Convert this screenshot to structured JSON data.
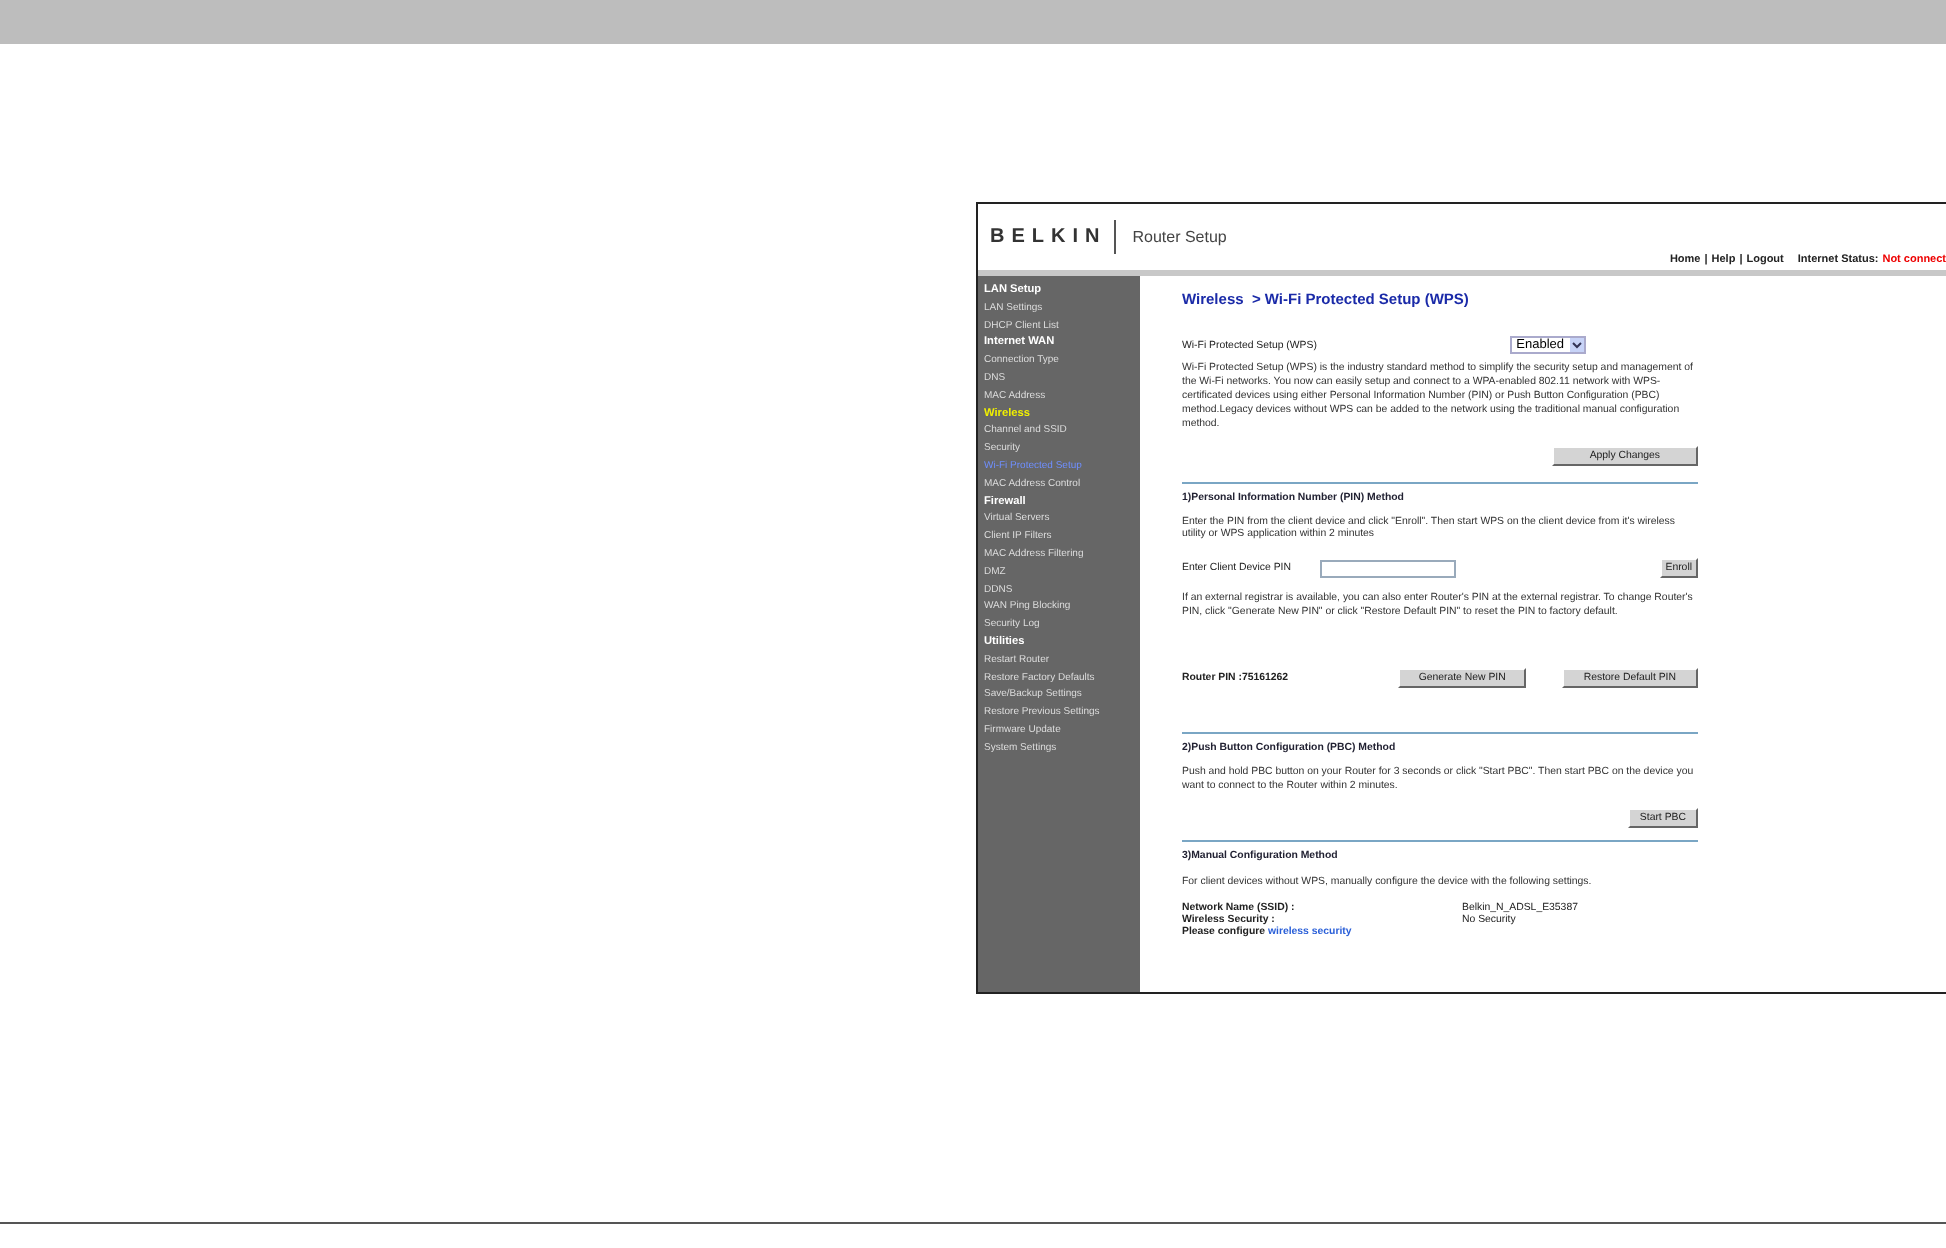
{
  "screenshot": {
    "logo": "BELKIN",
    "app_title": "Router Setup",
    "top_links": [
      "Home",
      "Help",
      "Logout"
    ],
    "link_separator": "|",
    "internet_status_label": "Internet Status:",
    "internet_status_value": "Not connect",
    "sidebar": {
      "items": [
        {
          "label": "LAN Setup",
          "kind": "heading",
          "selected": false
        },
        {
          "label": "LAN Settings",
          "kind": "link",
          "selected": false
        },
        {
          "label": "DHCP Client List",
          "kind": "link",
          "selected": false
        },
        {
          "label": "Internet WAN",
          "kind": "heading",
          "selected": false
        },
        {
          "label": "Connection Type",
          "kind": "link",
          "selected": false
        },
        {
          "label": "DNS",
          "kind": "link",
          "selected": false
        },
        {
          "label": "MAC Address",
          "kind": "link",
          "selected": false
        },
        {
          "label": "Wireless",
          "kind": "heading",
          "selected": true
        },
        {
          "label": "Channel and SSID",
          "kind": "link",
          "selected": false
        },
        {
          "label": "Security",
          "kind": "link",
          "selected": false
        },
        {
          "label": "Wi-Fi Protected Setup",
          "kind": "link",
          "selected": true
        },
        {
          "label": "MAC Address Control",
          "kind": "link",
          "selected": false
        },
        {
          "label": "Firewall",
          "kind": "heading",
          "selected": false
        },
        {
          "label": "Virtual Servers",
          "kind": "link",
          "selected": false
        },
        {
          "label": "Client IP Filters",
          "kind": "link",
          "selected": false
        },
        {
          "label": "MAC Address Filtering",
          "kind": "link",
          "selected": false
        },
        {
          "label": "DMZ",
          "kind": "link",
          "selected": false
        },
        {
          "label": "DDNS",
          "kind": "link",
          "selected": false
        },
        {
          "label": "WAN Ping Blocking",
          "kind": "link",
          "selected": false
        },
        {
          "label": "Security Log",
          "kind": "link",
          "selected": false
        },
        {
          "label": "Utilities",
          "kind": "heading",
          "selected": false
        },
        {
          "label": "Restart Router",
          "kind": "link",
          "selected": false
        },
        {
          "label": "Restore Factory Defaults",
          "kind": "link",
          "selected": false
        },
        {
          "label": "Save/Backup Settings",
          "kind": "link",
          "selected": false
        },
        {
          "label": "Restore Previous Settings",
          "kind": "link",
          "selected": false
        },
        {
          "label": "Firmware Update",
          "kind": "link",
          "selected": false
        },
        {
          "label": "System Settings",
          "kind": "link",
          "selected": false
        }
      ]
    },
    "breadcrumb": "Wireless  > Wi-Fi Protected Setup (WPS)",
    "wps": {
      "label": "Wi-Fi Protected Setup (WPS)",
      "value": "Enabled",
      "description": "Wi-Fi Protected Setup (WPS) is the industry standard method to simplify the security setup and management of the Wi-Fi networks. You now can easily setup and connect to a WPA-enabled 802.11 network with WPS-certificated devices using either Personal Information Number (PIN) or Push Button Configuration (PBC) method.Legacy devices without WPS can be added to the network using the traditional manual configuration method.",
      "apply_button": "Apply Changes"
    },
    "pin_method": {
      "heading": "1)Personal Information Number (PIN) Method",
      "instructions": "Enter the PIN from the client device and click \"Enroll\". Then start WPS on the client device from it's wireless utility or WPS application within 2 minutes",
      "field_label": "Enter Client Device PIN",
      "enroll_button": "Enroll",
      "external_note": "If an external registrar is available, you can also enter Router's PIN at the external registrar. To change Router's PIN, click \"Generate New PIN\" or click \"Restore Default PIN\" to reset the PIN to factory default.",
      "router_pin": "Router PIN :75161262",
      "generate_button": "Generate New PIN",
      "restore_button": "Restore Default PIN"
    },
    "pbc_method": {
      "heading": "2)Push Button Configuration (PBC) Method",
      "instructions": "Push and hold PBC button on your Router for 3 seconds or click \"Start PBC\". Then start PBC on the device you want to connect to the Router within 2 minutes.",
      "start_button": "Start PBC"
    },
    "manual_method": {
      "heading": "3)Manual Configuration Method",
      "instructions": "For client devices without WPS, manually configure the device with the following settings.",
      "settings": [
        {
          "label": "Network Name (SSID) :",
          "value": "Belkin_N_ADSL_E35387"
        },
        {
          "label": "Wireless Security :",
          "value": "No Security"
        }
      ],
      "configure_prefix": "Please configure",
      "configure_link": "wireless security"
    }
  }
}
